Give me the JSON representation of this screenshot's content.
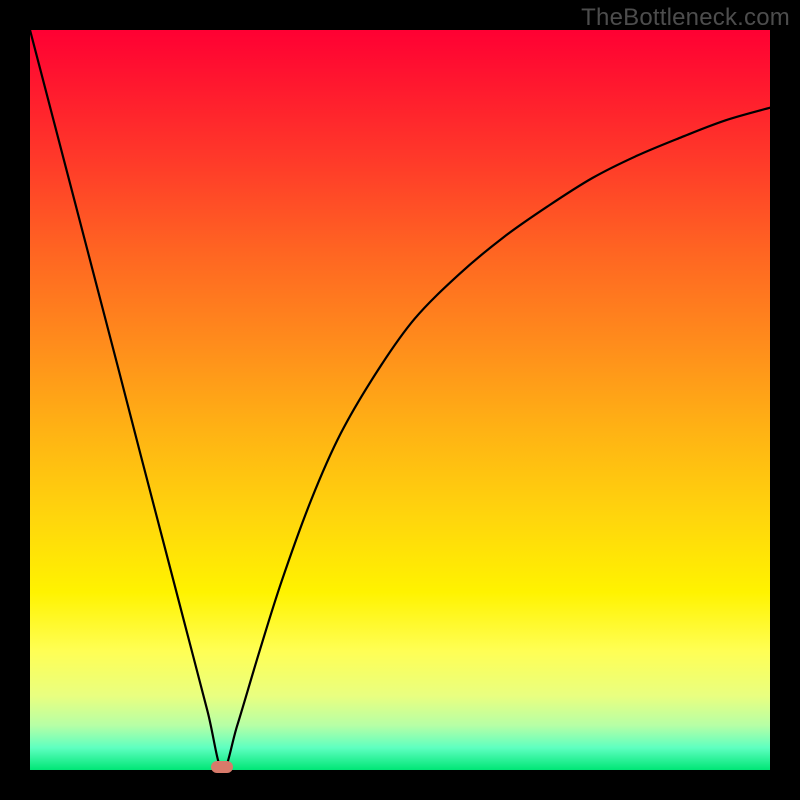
{
  "watermark": "TheBottleneck.com",
  "colors": {
    "frame": "#000000",
    "curve": "#000000",
    "marker": "#d87a6a",
    "gradient_top": "#ff0033",
    "gradient_bottom": "#00e676"
  },
  "chart_data": {
    "type": "line",
    "title": "",
    "xlabel": "",
    "ylabel": "",
    "xlim": [
      0,
      1
    ],
    "ylim": [
      0,
      1
    ],
    "min_point": {
      "x": 0.26,
      "y": 0.0
    },
    "series": [
      {
        "name": "bottleneck-curve",
        "x": [
          0.0,
          0.03,
          0.06,
          0.09,
          0.12,
          0.15,
          0.18,
          0.21,
          0.24,
          0.26,
          0.28,
          0.31,
          0.34,
          0.38,
          0.42,
          0.47,
          0.52,
          0.58,
          0.64,
          0.7,
          0.76,
          0.82,
          0.88,
          0.94,
          1.0
        ],
        "y": [
          1.0,
          0.885,
          0.77,
          0.655,
          0.54,
          0.424,
          0.309,
          0.194,
          0.079,
          0.0,
          0.06,
          0.16,
          0.255,
          0.365,
          0.455,
          0.54,
          0.61,
          0.67,
          0.72,
          0.762,
          0.8,
          0.83,
          0.855,
          0.878,
          0.895
        ]
      }
    ],
    "annotations": []
  }
}
